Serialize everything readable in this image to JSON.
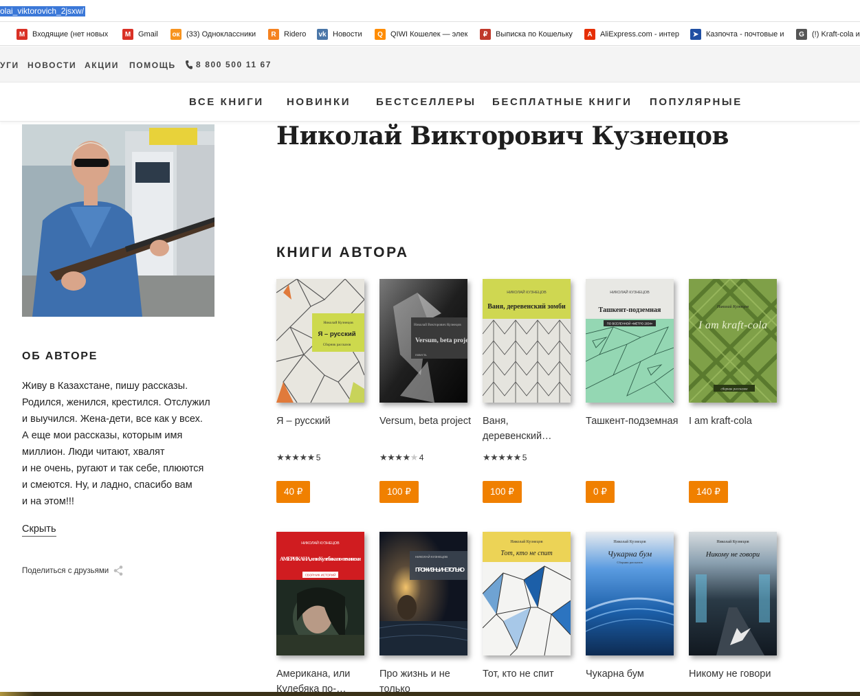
{
  "browser": {
    "url_fragment": "olai_viktorovich_2jsxw/",
    "bookmarks": [
      {
        "label": "Входящие (нет новых",
        "icon": "gmail-inbox-icon",
        "color": "#d93025"
      },
      {
        "label": "Gmail",
        "icon": "gmail-icon",
        "color": "#d93025"
      },
      {
        "label": "(33) Одноклассники",
        "icon": "odnoklassniki-icon",
        "color": "#f7931e"
      },
      {
        "label": "Ridero",
        "icon": "ridero-icon",
        "color": "#f58220"
      },
      {
        "label": "Новости",
        "icon": "vk-icon",
        "color": "#4a76a8"
      },
      {
        "label": "QIWI Кошелек — элек",
        "icon": "qiwi-icon",
        "color": "#ff8c00"
      },
      {
        "label": "Выписка по Кошельку",
        "icon": "wallet-icon",
        "color": "#c0392b"
      },
      {
        "label": "AliExpress.com - интер",
        "icon": "aliexpress-icon",
        "color": "#e62e04"
      },
      {
        "label": "Казпочта - почтовые и",
        "icon": "kazpost-icon",
        "color": "#1f4fa3"
      },
      {
        "label": "(!) Kraft-cola и",
        "icon": "google-search-icon",
        "color": "#555555"
      }
    ]
  },
  "topnav": {
    "items": [
      "УГИ",
      "НОВОСТИ",
      "АКЦИИ",
      "ПОМОЩЬ"
    ],
    "phone": "8 800 500 11 67"
  },
  "catnav": [
    "ВСЕ КНИГИ",
    "НОВИНКИ",
    "БЕСТСЕЛЛЕРЫ",
    "БЕСПЛАТНЫЕ КНИГИ",
    "ПОПУЛЯРНЫЕ"
  ],
  "author": {
    "name": "Николай Викторович Кузнецов",
    "about_title": "ОБ АВТОРЕ",
    "about_lines": [
      "Живу в Казахстане, пишу рассказы.",
      "Родился, женился, крестился. Отслужил",
      "и выучился. Жена-дети, все как у всех.",
      "А еще мои рассказы, которым имя",
      "миллион. Люди читают, хвалят",
      "и не очень, ругают и так себе, плюются",
      "и смеются. Ну, и ладно, спасибо вам",
      "и на этом!!!"
    ],
    "hide_label": "Скрыть",
    "share_label": "Поделиться с друзьями"
  },
  "books_title": "КНИГИ АВТОРА",
  "books": [
    {
      "title": "Я – русский",
      "rating_stars": 5,
      "rating": "5",
      "price": "40 ₽",
      "cover": {
        "author": "Николай Кузнецов",
        "title": "Я – русский",
        "subtitle": "Сборник рассказов"
      }
    },
    {
      "title": "Versum, beta project",
      "rating_stars": 4,
      "rating": "4",
      "price": "100 ₽",
      "cover": {
        "author": "Николай Викторович Кузнецов",
        "title": "Versum, beta project",
        "subtitle": "повесть"
      }
    },
    {
      "title": "Ваня, деревенский…",
      "rating_stars": 5,
      "rating": "5",
      "price": "100 ₽",
      "cover": {
        "author": "НИКОЛАЙ КУЗНЕЦОВ",
        "title": "Ваня, деревенский зомби",
        "subtitle": ""
      }
    },
    {
      "title": "Ташкент-подземная",
      "rating_stars": 0,
      "rating": "",
      "price": "0 ₽",
      "cover": {
        "author": "НИКОЛАЙ КУЗНЕЦОВ",
        "title": "Ташкент-подземная",
        "subtitle": "ПО ВСЕЛЕННОЙ «МЕТРО 2034»"
      }
    },
    {
      "title": "I am kraft-cola",
      "rating_stars": 0,
      "rating": "",
      "price": "140 ₽",
      "cover": {
        "author": "Николай Кузнецов",
        "title": "I am kraft-cola",
        "subtitle": "сборник рассказов"
      }
    },
    {
      "title": "Американа, или Кулебяка по-…",
      "cover": {
        "author": "НИКОЛАЙ КУЗНЕЦОВ",
        "title": "АМЕРИКАНА, или Кулебяка по-пекински",
        "subtitle": "СБОРНИК ИСТОРИЙ"
      }
    },
    {
      "title": "Про жизнь и не только",
      "cover": {
        "author": "НИКОЛАЙ КУЗНЕЦОВ",
        "title": "ПРО ЖИЗНЬ И НЕ ТОЛЬКО",
        "subtitle": ""
      }
    },
    {
      "title": "Тот, кто не спит",
      "cover": {
        "author": "Николай Кузнецов",
        "title": "Тот, кто не спит",
        "subtitle": ""
      }
    },
    {
      "title": "Чукарна бум",
      "cover": {
        "author": "Николай Кузнецов",
        "title": "Чукарна бум",
        "subtitle": "Сборник рассказов"
      }
    },
    {
      "title": "Никому не говори",
      "cover": {
        "author": "Николай Кузнецов",
        "title": "Никому не говори",
        "subtitle": ""
      }
    }
  ],
  "colors": {
    "accent": "#f08000",
    "url_highlight": "#3b78d8"
  }
}
